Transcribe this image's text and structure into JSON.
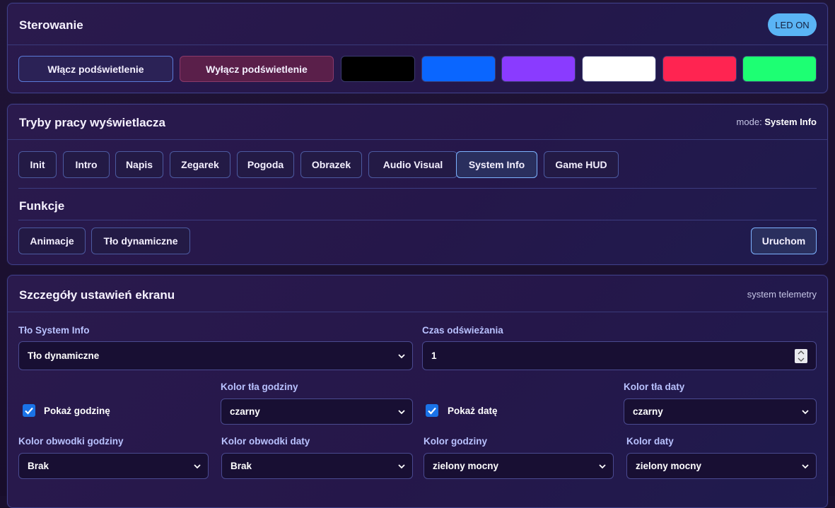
{
  "control": {
    "title": "Sterowanie",
    "led_badge": "LED ON",
    "on_button": "Włącz podświetlenie",
    "off_button": "Wyłącz podświetlenie",
    "colors": [
      "#000000",
      "#0a66ff",
      "#8a3bff",
      "#ffffff",
      "#ff2451",
      "#1dff73"
    ]
  },
  "modes": {
    "title": "Tryby pracy wyświetlacza",
    "mode_prefix": "mode:",
    "mode_value": "System Info",
    "tabs": [
      "Init",
      "Intro",
      "Napis",
      "Zegarek",
      "Pogoda",
      "Obrazek",
      "Audio Visual",
      "System Info",
      "Game HUD"
    ],
    "active_tab": "System Info",
    "functions_title": "Funkcje",
    "functions": [
      "Animacje",
      "Tło dynamiczne"
    ],
    "run_button": "Uruchom"
  },
  "details": {
    "title": "Szczegóły ustawień ekranu",
    "subtitle": "system telemetry",
    "bg_label": "Tło System Info",
    "bg_value": "Tło dynamiczne",
    "refresh_label": "Czas odświeżania",
    "refresh_value": "1",
    "show_hour_label": "Pokaż godzinę",
    "show_hour_checked": true,
    "hour_bg_label": "Kolor tła godziny",
    "hour_bg_value": "czarny",
    "show_date_label": "Pokaż datę",
    "show_date_checked": true,
    "date_bg_label": "Kolor tła daty",
    "date_bg_value": "czarny",
    "hour_outline_label": "Kolor obwodki godziny",
    "hour_outline_value": "Brak",
    "date_outline_label": "Kolor obwodki daty",
    "date_outline_value": "Brak",
    "hour_color_label": "Kolor godziny",
    "hour_color_value": "zielony mocny",
    "date_color_label": "Kolor daty",
    "date_color_value": "zielony mocny"
  }
}
